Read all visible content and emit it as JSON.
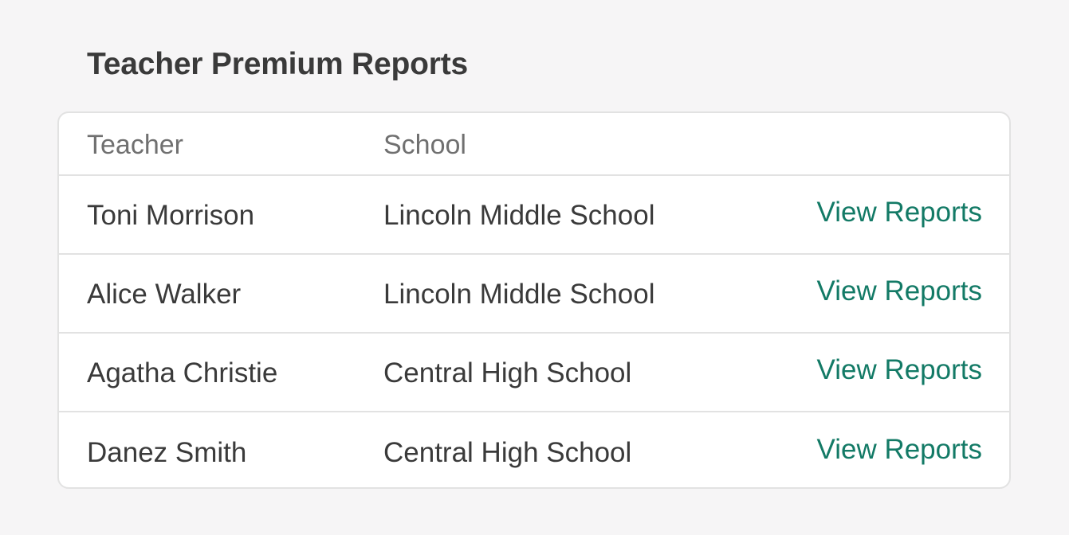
{
  "page": {
    "title": "Teacher Premium Reports"
  },
  "table": {
    "headers": {
      "teacher": "Teacher",
      "school": "School",
      "action": ""
    },
    "rows": [
      {
        "teacher": "Toni Morrison",
        "school": "Lincoln Middle School",
        "action": "View Reports"
      },
      {
        "teacher": "Alice Walker",
        "school": "Lincoln Middle School",
        "action": "View Reports"
      },
      {
        "teacher": "Agatha Christie",
        "school": "Central High School",
        "action": "View Reports"
      },
      {
        "teacher": "Danez Smith",
        "school": "Central High School",
        "action": "View Reports"
      }
    ]
  },
  "colors": {
    "background": "#f6f5f6",
    "card": "#ffffff",
    "border": "#e2e2e2",
    "text": "#3a3a3a",
    "muted": "#707070",
    "link": "#137a66"
  }
}
